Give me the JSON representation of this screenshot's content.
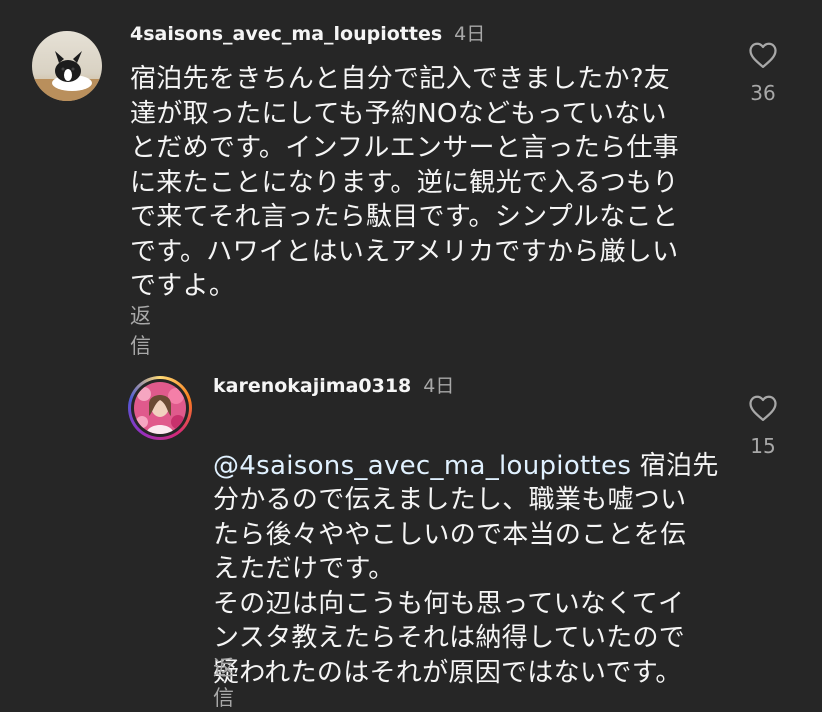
{
  "comments": [
    {
      "username": "4saisons_avec_ma_loupiottes",
      "time": "4日",
      "text": "宿泊先をきちんと自分で記入できましたか?友\n達が取ったにしても予約NOなどもっていない\nとだめです。インフルエンサーと言ったら仕事\nに来たことになります。逆に観光で入るつもり\nで来てそれ言ったら駄目です。シンプルなこと\nです。ハワイとはいえアメリカですから厳しい\nですよ。",
      "reply_label": "返信",
      "like_count": "36",
      "avatar_icon": "french-bulldog-avatar"
    }
  ],
  "replies": [
    {
      "username": "karenokajima0318",
      "time": "4日",
      "mention": "@4saisons_avec_ma_loupiottes",
      "text_first": " 宿泊先",
      "text": "分かるので伝えましたし、職業も嘘つい\nたら後々ややこしいので本当のことを伝\nえただけです。\nその辺は向こうも何も思っていなくてイ\nンスタ教えたらそれは納得していたので\n疑われたのはそれが原因ではないです。",
      "reply_label": "返信",
      "like_count": "15",
      "avatar_icon": "woman-flowers-avatar"
    }
  ],
  "colors": {
    "background": "#262626",
    "text_primary": "#f5f5f5",
    "text_secondary": "#a8a8a8",
    "mention": "#e0f1ff"
  }
}
